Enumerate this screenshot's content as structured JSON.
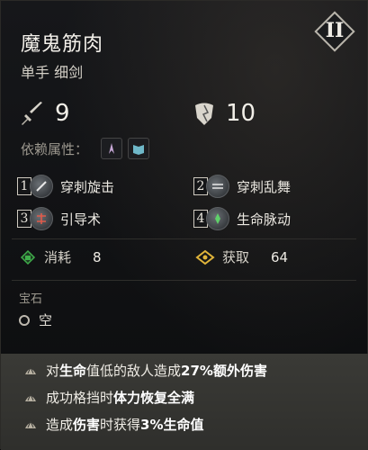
{
  "item": {
    "name": "魔鬼筋肉",
    "type": "单手 细剑",
    "level": "II"
  },
  "stats": {
    "attack": "9",
    "defense": "10"
  },
  "requirements": {
    "label": "依赖属性："
  },
  "skills": [
    {
      "num": "1",
      "name": "穿刺旋击"
    },
    {
      "num": "2",
      "name": "穿刺乱舞"
    },
    {
      "num": "3",
      "name": "引导术"
    },
    {
      "num": "4",
      "name": "生命脉动"
    }
  ],
  "cost": {
    "consume_label": "消耗",
    "consume_value": "8",
    "gain_label": "获取",
    "gain_value": "64"
  },
  "gems": {
    "heading": "宝石",
    "slot_text": "空"
  },
  "effects": [
    {
      "parts": [
        "对",
        "生命",
        "值低的敌人造成",
        "27%",
        "额外伤害"
      ]
    },
    {
      "parts": [
        "成功格挡时",
        "体力恢复全满"
      ]
    },
    {
      "parts": [
        "造成",
        "伤害",
        "时获得",
        "3%生命值"
      ]
    }
  ],
  "colors": {
    "gain_icon": "#e0b43a",
    "consume_icon": "#3fae4a",
    "effects_band": "#363632"
  }
}
